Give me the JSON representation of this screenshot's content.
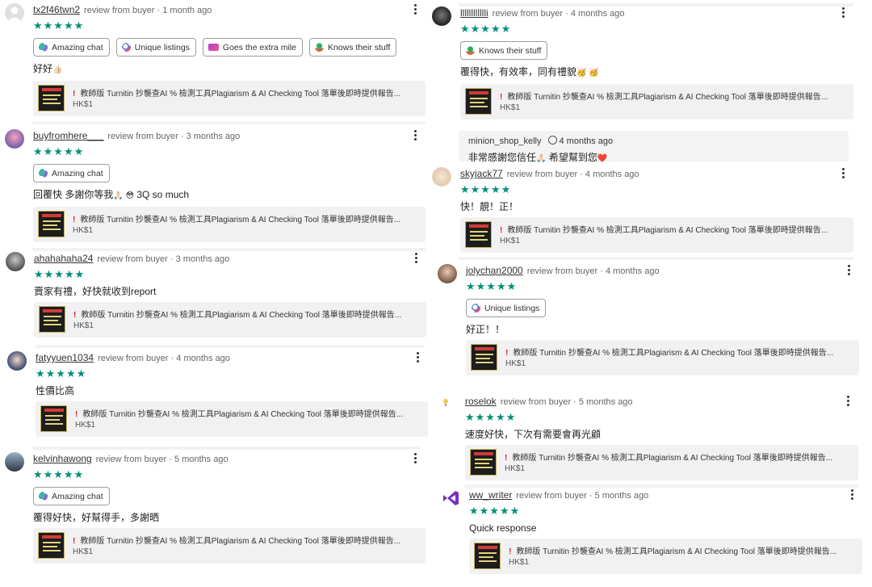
{
  "meta_suffix": "review from buyer",
  "stars": "★★★★★",
  "listing": {
    "title": "教師版 Turnitin 抄襲查AI % 檢測工具Plagiarism & AI Checking Tool 落單後即時提供報告...",
    "price": "HK$1",
    "alert": "!"
  },
  "tags": {
    "amazing_chat": "Amazing chat",
    "unique_listings": "Unique listings",
    "extra_mile": "Goes the extra mile",
    "knows_stuff": "Knows their stuff"
  },
  "reviews": [
    {
      "username": "tx2f46twn2",
      "time": "1 month ago",
      "text": "好好",
      "emoji": "👍🏻"
    },
    {
      "username": "buyfromhere___",
      "time": "3 months ago",
      "text": "回覆快 多謝你等我",
      "emoji": "🙏🏻 😳",
      "text_suffix": "3Q so much"
    },
    {
      "username": "ahahahaha24",
      "time": "3 months ago",
      "text": "賣家有禮，好快就收到report"
    },
    {
      "username": "fatyyuen1034",
      "time": "4 months ago",
      "text": "性價比高"
    },
    {
      "username": "kelvinhawong",
      "time": "5 months ago",
      "text": "覆得好快，好幫得手，多謝晒"
    },
    {
      "username": "lllllllllllli",
      "time": "4 months ago",
      "text": "覆得快，有效率，同有禮貌",
      "emoji": "🥳 🥳"
    },
    {
      "username": "skyjack77",
      "time": "4 months ago",
      "text": "快！靚！正！"
    },
    {
      "username": "jolychan2000",
      "time": "4 months ago",
      "text": "好正！！"
    },
    {
      "username": "roselok",
      "time": "5 months ago",
      "text": "速度好快，下次有需要會再光顧"
    },
    {
      "username": "ww_writer",
      "time": "5 months ago",
      "text": "Quick response"
    }
  ],
  "seller_reply": {
    "username": "minion_shop_kelly",
    "time": "4 months ago",
    "text": "非常感謝您信任",
    "text_suffix": "希望幫到您",
    "emoji1": "🙏🏻",
    "emoji2": "❤️"
  }
}
